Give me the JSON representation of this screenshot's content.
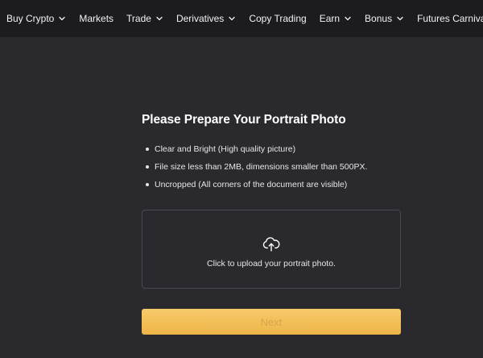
{
  "nav": {
    "items": [
      {
        "label": "Buy Crypto",
        "dropdown": true
      },
      {
        "label": "Markets",
        "dropdown": false
      },
      {
        "label": "Trade",
        "dropdown": true
      },
      {
        "label": "Derivatives",
        "dropdown": true
      },
      {
        "label": "Copy Trading",
        "dropdown": false
      },
      {
        "label": "Earn",
        "dropdown": true
      },
      {
        "label": "Bonus",
        "dropdown": true
      },
      {
        "label": "Futures Carnival",
        "dropdown": false
      }
    ]
  },
  "main": {
    "title": "Please Prepare Your Portrait Photo",
    "requirements": [
      "Clear and Bright (High quality picture)",
      "File size less than 2MB, dimensions smaller than 500PX.",
      "Uncropped (All corners of the document are visible)"
    ],
    "upload": {
      "icon": "cloud-upload-icon",
      "text": "Click to upload your portrait photo."
    },
    "next_label": "Next"
  },
  "colors": {
    "background": "#2a292e",
    "nav_background": "#1c1b20",
    "accent": "#f0b90b",
    "button_gradient_top": "#f7ca6a",
    "button_gradient_bottom": "#eeb548"
  }
}
